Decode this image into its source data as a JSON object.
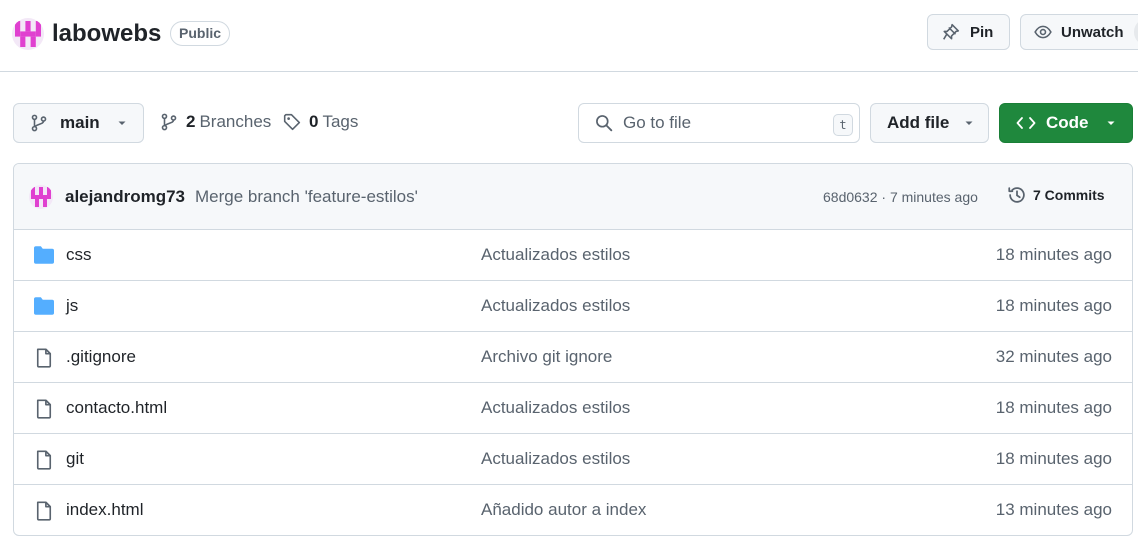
{
  "repo": {
    "name": "labowebs",
    "visibility": "Public"
  },
  "actions": {
    "pin_label": "Pin",
    "unwatch_label": "Unwatch",
    "unwatch_count": ""
  },
  "toolbar": {
    "branch": "main",
    "branches_count": "2",
    "branches_label": "Branches",
    "tags_count": "0",
    "tags_label": "Tags",
    "search_placeholder": "Go to file",
    "search_shortcut": "t",
    "add_file_label": "Add file",
    "code_label": "Code"
  },
  "latest_commit": {
    "author": "alejandromg73",
    "message": "Merge branch 'feature-estilos'",
    "meta": "68d0632 · 7 minutes ago",
    "commits_label": "7 Commits"
  },
  "files": [
    {
      "name": "css",
      "type": "folder",
      "message": "Actualizados estilos",
      "date": "18 minutes ago"
    },
    {
      "name": "js",
      "type": "folder",
      "message": "Actualizados estilos",
      "date": "18 minutes ago"
    },
    {
      "name": ".gitignore",
      "type": "file",
      "message": "Archivo git ignore",
      "date": "32 minutes ago"
    },
    {
      "name": "contacto.html",
      "type": "file",
      "message": "Actualizados estilos",
      "date": "18 minutes ago"
    },
    {
      "name": "git",
      "type": "file",
      "message": "Actualizados estilos",
      "date": "18 minutes ago"
    },
    {
      "name": "index.html",
      "type": "file",
      "message": "Añadido autor a index",
      "date": "13 minutes ago"
    }
  ],
  "colors": {
    "accent_green": "#1f883d",
    "folder_blue": "#54aeff",
    "avatar_magenta": "#e040d0"
  }
}
